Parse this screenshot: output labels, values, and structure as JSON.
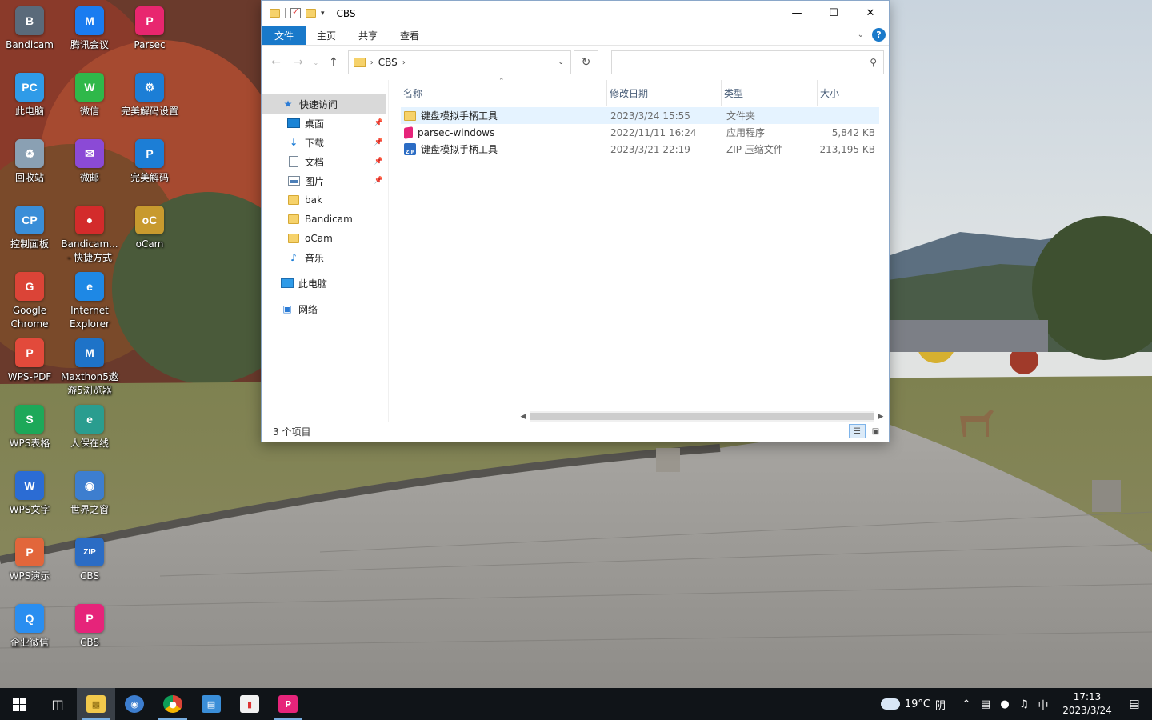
{
  "desktop": {
    "icons": [
      {
        "label": "Bandicam",
        "glyph": "B",
        "color": "#5a6a7a"
      },
      {
        "label": "腾讯会议",
        "glyph": "M",
        "color": "#1a7cf0"
      },
      {
        "label": "Parsec",
        "glyph": "P",
        "color": "#e8266f"
      },
      {
        "label": "此电脑",
        "glyph": "PC",
        "color": "#2f9be8"
      },
      {
        "label": "微信",
        "glyph": "W",
        "color": "#2fb84a"
      },
      {
        "label": "完美解码设置",
        "glyph": "⚙",
        "color": "#1c7ed6"
      },
      {
        "label": "回收站",
        "glyph": "♻",
        "color": "#8aa0b3"
      },
      {
        "label": "微邮",
        "glyph": "✉",
        "color": "#8b4ad6"
      },
      {
        "label": "完美解码",
        "glyph": "P",
        "color": "#1c7ed6"
      },
      {
        "label": "控制面板",
        "glyph": "CP",
        "color": "#3a8ed8"
      },
      {
        "label": "Bandicam...\n- 快捷方式",
        "glyph": "●",
        "color": "#d32b2b"
      },
      {
        "label": "oCam",
        "glyph": "oC",
        "color": "#c89a2e"
      },
      {
        "label": "Google\nChrome",
        "glyph": "G",
        "color": "#db4437"
      },
      {
        "label": "Internet\nExplorer",
        "glyph": "e",
        "color": "#1e88e5"
      },
      {
        "label": "WPS-PDF",
        "glyph": "P",
        "color": "#e24a3b"
      },
      {
        "label": "Maxthon5遨\n游5浏览器",
        "glyph": "M",
        "color": "#1e73c8"
      },
      {
        "label": "WPS表格",
        "glyph": "S",
        "color": "#1da859"
      },
      {
        "label": "人保在线",
        "glyph": "e",
        "color": "#2a9d8f"
      },
      {
        "label": "WPS文字",
        "glyph": "W",
        "color": "#2b6cd4"
      },
      {
        "label": "世界之窗",
        "glyph": "◉",
        "color": "#3d7ecf"
      },
      {
        "label": "WPS演示",
        "glyph": "P",
        "color": "#e2663b"
      },
      {
        "label": "CBS",
        "glyph": "ZIP",
        "color": "#2b6cc4"
      },
      {
        "label": "企业微信",
        "glyph": "Q",
        "color": "#2a8ef0"
      },
      {
        "label": "CBS",
        "glyph": "P",
        "color": "#e6247a"
      }
    ]
  },
  "explorer": {
    "title": "CBS",
    "ribbon_tabs": [
      "文件",
      "主页",
      "共享",
      "查看"
    ],
    "help": "?",
    "address": {
      "crumbs": [
        "CBS"
      ]
    },
    "search": {
      "placeholder": "",
      "value": ""
    },
    "nav": {
      "quick_access": "快速访问",
      "items": [
        {
          "label": "桌面",
          "icon": "desktop-icon",
          "pinned": true
        },
        {
          "label": "下载",
          "icon": "download-icon",
          "pinned": true
        },
        {
          "label": "文档",
          "icon": "document-icon",
          "pinned": true
        },
        {
          "label": "图片",
          "icon": "pictures-icon",
          "pinned": true
        },
        {
          "label": "bak",
          "icon": "folder-icon",
          "pinned": false
        },
        {
          "label": "Bandicam",
          "icon": "folder-icon",
          "pinned": false
        },
        {
          "label": "oCam",
          "icon": "folder-icon",
          "pinned": false
        },
        {
          "label": "音乐",
          "icon": "music-icon",
          "pinned": false
        }
      ],
      "this_pc": "此电脑",
      "network": "网络"
    },
    "columns": {
      "name": "名称",
      "date": "修改日期",
      "type": "类型",
      "size": "大小"
    },
    "files": [
      {
        "name": "键盘模拟手柄工具",
        "date": "2023/3/24 15:55",
        "type": "文件夹",
        "size": "",
        "icon": "folder"
      },
      {
        "name": "parsec-windows",
        "date": "2022/11/11 16:24",
        "type": "应用程序",
        "size": "5,842 KB",
        "icon": "app"
      },
      {
        "name": "键盘模拟手柄工具",
        "date": "2023/3/21 22:19",
        "type": "ZIP 压缩文件",
        "size": "213,195 KB",
        "icon": "zip"
      }
    ],
    "status": "3 个项目"
  },
  "taskbar": {
    "weather": {
      "temp": "19°C",
      "condition": "阴"
    },
    "ime": "中",
    "time": "17:13",
    "date": "2023/3/24"
  }
}
